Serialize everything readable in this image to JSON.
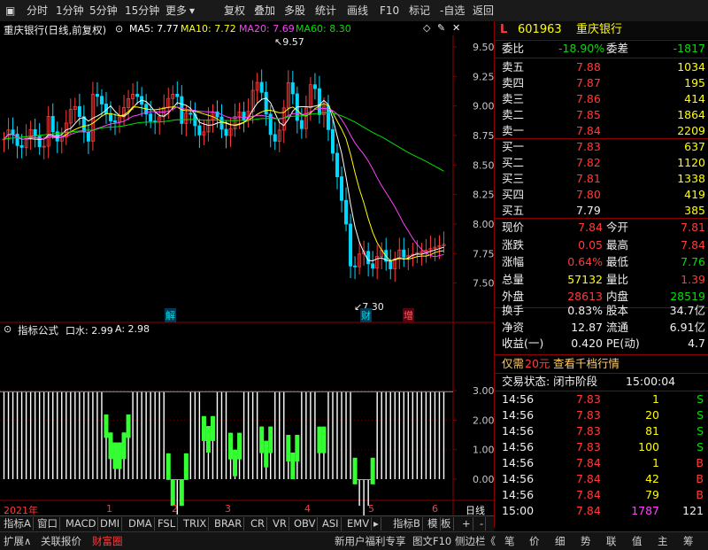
{
  "toolbar": {
    "items": [
      "分时",
      "1分钟",
      "5分钟",
      "15分钟",
      "更多"
    ],
    "more_arrow": "▾",
    "right_items": [
      "复权",
      "叠加",
      "多股",
      "统计",
      "画线",
      "F10",
      "标记",
      "-自选",
      "返回"
    ]
  },
  "main": {
    "title": "重庆银行(日线,前复权)",
    "ma5": "MA5: 7.77",
    "ma10": "MA10: 7.72",
    "ma20": "MA20: 7.69",
    "ma60": "MA60: 8.30",
    "price_ticks": [
      "9.50",
      "9.25",
      "9.00",
      "8.75",
      "8.50",
      "8.25",
      "8.00",
      "7.75",
      "7.50"
    ],
    "high_label": "9.57",
    "low_label": "7.30",
    "markers": [
      "解",
      "财",
      "增"
    ],
    "indicator_title": "指标公式",
    "indicator_k": "口水: 2.99",
    "indicator_a": "A: 2.98",
    "ind_ticks": [
      "3.00",
      "2.00",
      "1.00",
      "0.00"
    ],
    "date_labels": [
      "2021年",
      "1",
      "2",
      "3",
      "4",
      "5",
      "6"
    ],
    "period": "日线",
    "colors": {
      "ma5": "#ffffff",
      "ma10": "#ffff00",
      "ma20": "#ff40ff",
      "ma60": "#00e000",
      "up": "#ff3b3b",
      "down": "#00ffff"
    }
  },
  "tabs": [
    "指标A",
    "窗口",
    "MACD",
    "DMI",
    "DMA",
    "FSL",
    "TRIX",
    "BRAR",
    "CR",
    "VR",
    "OBV",
    "ASI",
    "EMV",
    "▸",
    "指标B",
    "模",
    "板",
    "+",
    "-"
  ],
  "status": {
    "left": [
      "扩展∧",
      "关联报价",
      "财富圈"
    ],
    "mid": [
      "新用户福利专享",
      "图文F10",
      "侧边栏《"
    ],
    "right": [
      "笔",
      "价",
      "细",
      "势",
      "联",
      "值",
      "主",
      "筹"
    ]
  },
  "quote": {
    "code": "601963",
    "name": "重庆银行",
    "weibi_label": "委比",
    "weibi_value": "-18.90%",
    "weicha_label": "委差",
    "weicha_value": "-1817",
    "sells": [
      {
        "label": "卖五",
        "price": "7.88",
        "vol": "1034"
      },
      {
        "label": "卖四",
        "price": "7.87",
        "vol": "195"
      },
      {
        "label": "卖三",
        "price": "7.86",
        "vol": "414"
      },
      {
        "label": "卖二",
        "price": "7.85",
        "vol": "1864"
      },
      {
        "label": "卖一",
        "price": "7.84",
        "vol": "2209"
      }
    ],
    "buys": [
      {
        "label": "买一",
        "price": "7.83",
        "vol": "637"
      },
      {
        "label": "买二",
        "price": "7.82",
        "vol": "1120"
      },
      {
        "label": "买三",
        "price": "7.81",
        "vol": "1338"
      },
      {
        "label": "买四",
        "price": "7.80",
        "vol": "419"
      },
      {
        "label": "买五",
        "price": "7.79",
        "vol": "385"
      }
    ],
    "stats": [
      {
        "l1": "现价",
        "v1": "7.84",
        "l2": "今开",
        "v2": "7.81"
      },
      {
        "l1": "涨跌",
        "v1": "0.05",
        "l2": "最高",
        "v2": "7.84"
      },
      {
        "l1": "涨幅",
        "v1": "0.64%",
        "l2": "最低",
        "v2": "7.76"
      },
      {
        "l1": "总量",
        "v1": "57132",
        "l2": "量比",
        "v2": "1.39"
      },
      {
        "l1": "外盘",
        "v1": "28613",
        "l2": "内盘",
        "v2": "28519"
      }
    ],
    "stats2": [
      {
        "l1": "换手",
        "v1": "0.83%",
        "l2": "股本",
        "v2": "34.7亿"
      },
      {
        "l1": "净资",
        "v1": "12.87",
        "l2": "流通",
        "v2": "6.91亿"
      },
      {
        "l1": "收益(一)",
        "v1": "0.420",
        "l2": "PE(动)",
        "v2": "4.7"
      }
    ],
    "promo_pre": "仅需",
    "promo_price": "20元",
    "promo_post": "查看千档行情",
    "trade_state_label": "交易状态: 闭市阶段",
    "trade_state_time": "15:00:04",
    "ticks": [
      {
        "t": "14:56",
        "p": "7.83",
        "v": "1",
        "d": "S"
      },
      {
        "t": "14:56",
        "p": "7.83",
        "v": "20",
        "d": "S"
      },
      {
        "t": "14:56",
        "p": "7.83",
        "v": "81",
        "d": "S"
      },
      {
        "t": "14:56",
        "p": "7.83",
        "v": "100",
        "d": "S"
      },
      {
        "t": "14:56",
        "p": "7.84",
        "v": "1",
        "d": "B"
      },
      {
        "t": "14:56",
        "p": "7.84",
        "v": "42",
        "d": "B"
      },
      {
        "t": "14:56",
        "p": "7.84",
        "v": "79",
        "d": "B"
      },
      {
        "t": "15:00",
        "p": "7.84",
        "v": "1787",
        "d": "121"
      }
    ]
  }
}
